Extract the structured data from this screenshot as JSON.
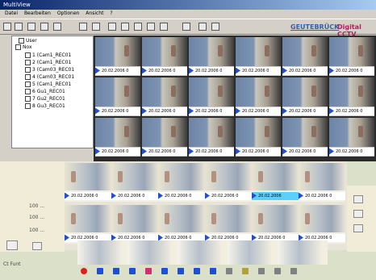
{
  "window": {
    "title": "MultiView"
  },
  "menu": [
    "Datei",
    "Bearbeiten",
    "Optionen",
    "Ansicht",
    "?"
  ],
  "brand": {
    "left": "GEUTEBRÜCK",
    "right": "Digital CCTV"
  },
  "tree": {
    "root": "User",
    "sub": "Nox",
    "items": [
      "1 (Cam1_REC01",
      "2 (Cam1_REC01",
      "3 (Cam03_REC01",
      "4 (Cam03_REC01",
      "5 (Cam1_REC01",
      "6 Gu1_REC01",
      "7 Gu2_REC01",
      "8 Gu3_REC01"
    ]
  },
  "grid_top": {
    "timestamp": "20.02.2006 0"
  },
  "grid_bottom": {
    "timestamp": "20.02.2006 0",
    "selected_timestamp": "20.02.2006"
  },
  "left_panel": {
    "labels": [
      "100 ...",
      "100 ...",
      "100 ..."
    ],
    "footer": "Ct Funt"
  },
  "colors": {
    "brand_left": "#3060b0",
    "brand_right": "#c01860",
    "play_icon": "#1f4fd0",
    "selected_label": "#5ad0ff"
  }
}
